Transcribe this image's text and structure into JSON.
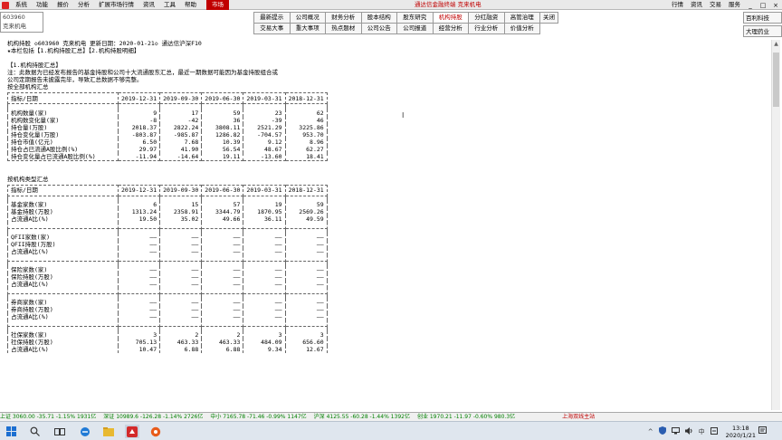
{
  "menubar": {
    "items": [
      "系统",
      "功能",
      "报价",
      "分析",
      "扩展市场行情",
      "资讯",
      "工具",
      "帮助"
    ],
    "market_label": "市场",
    "center_title": "通达信金融终端  克来机电",
    "right_items": [
      "行情",
      "资讯",
      "交易",
      "服务"
    ],
    "window_buttons": [
      "_",
      "□",
      "×"
    ]
  },
  "stock": {
    "code": "603960",
    "name": "克来机电"
  },
  "tabs": {
    "row1": [
      "最新提示",
      "公司概况",
      "财务分析",
      "股本结构",
      "股东研究",
      "机构持股",
      "分红融资",
      "高管治理",
      "关闭"
    ],
    "row2": [
      "交易大事",
      "重大事项",
      "热点题材",
      "公司公告",
      "公司报道",
      "经营分析",
      "行业分析",
      "价值分析"
    ],
    "active": "机构持股"
  },
  "side_buttons": [
    "百利科技",
    "大理药业"
  ],
  "content": {
    "header_line": "机构持股 ◇603960 克来机电 更新日期：2020-01-21◇ 通达信沪深F10",
    "index_line": "★本栏包括【1.机构持股汇总】【2.机构持股明细】",
    "section_title": "【1.机构持股汇总】",
    "note_lines": [
      "注：此数据为已经发布报告的基金持股和公司十大流通股东汇总，最近一期数据可能因为基金持股组合或",
      "公司定期报告未披露完毕，导致汇总数据不够完整。"
    ],
    "table1": {
      "caption": "按全部机构汇总",
      "header_label": "指标/日期",
      "dates": [
        "2019-12-31",
        "2019-09-30",
        "2019-06-30",
        "2019-03-31",
        "2018-12-31"
      ],
      "rows": [
        {
          "label": "机构数量(家)",
          "values": [
            "9",
            "17",
            "59",
            "23",
            "62"
          ]
        },
        {
          "label": "机构数变化量(家)",
          "values": [
            "-8",
            "-42",
            "36",
            "-39",
            "46"
          ]
        },
        {
          "label": "持仓量(万股)",
          "values": [
            "2018.37",
            "2822.24",
            "3808.11",
            "2521.29",
            "3225.86"
          ]
        },
        {
          "label": "持仓变化量(万股)",
          "values": [
            "-803.87",
            "-985.87",
            "1286.82",
            "-704.57",
            "953.70"
          ]
        },
        {
          "label": "持仓市值(亿元)",
          "values": [
            "6.50",
            "7.68",
            "10.39",
            "9.12",
            "8.96"
          ]
        },
        {
          "label": "持仓占已流通A股比例(%)",
          "values": [
            "29.97",
            "41.90",
            "56.54",
            "48.67",
            "62.27"
          ]
        },
        {
          "label": "持仓变化量占已流通A股比例(%)",
          "values": [
            "-11.94",
            "-14.64",
            "19.11",
            "-13.60",
            "18.41"
          ]
        }
      ]
    },
    "table2": {
      "caption": "按机构类型汇总",
      "header_label": "指标/日期",
      "dates": [
        "2019-12-31",
        "2019-09-30",
        "2019-06-30",
        "2019-03-31",
        "2018-12-31"
      ],
      "groups": [
        {
          "rows": [
            {
              "label": "基金家数(家)",
              "values": [
                "6",
                "15",
                "57",
                "19",
                "59"
              ]
            },
            {
              "label": "基金持股(万股)",
              "values": [
                "1313.24",
                "2358.91",
                "3344.79",
                "1870.95",
                "2569.26"
              ]
            },
            {
              "label": "占流通A比(%)",
              "values": [
                "19.50",
                "35.02",
                "49.66",
                "36.11",
                "49.59"
              ]
            }
          ]
        },
        {
          "rows": [
            {
              "label": "QFII家数(家)",
              "values": [
                "——",
                "——",
                "——",
                "——",
                "——"
              ]
            },
            {
              "label": "QFII持股(万股)",
              "values": [
                "——",
                "——",
                "——",
                "——",
                "——"
              ]
            },
            {
              "label": "占流通A比(%)",
              "values": [
                "——",
                "——",
                "——",
                "——",
                "——"
              ]
            }
          ]
        },
        {
          "rows": [
            {
              "label": "保险家数(家)",
              "values": [
                "——",
                "——",
                "——",
                "——",
                "——"
              ]
            },
            {
              "label": "保险持股(万股)",
              "values": [
                "——",
                "——",
                "——",
                "——",
                "——"
              ]
            },
            {
              "label": "占流通A比(%)",
              "values": [
                "——",
                "——",
                "——",
                "——",
                "——"
              ]
            }
          ]
        },
        {
          "rows": [
            {
              "label": "券商家数(家)",
              "values": [
                "——",
                "——",
                "——",
                "——",
                "——"
              ]
            },
            {
              "label": "券商持股(万股)",
              "values": [
                "——",
                "——",
                "——",
                "——",
                "——"
              ]
            },
            {
              "label": "占流通A比(%)",
              "values": [
                "——",
                "——",
                "——",
                "——",
                "——"
              ]
            }
          ]
        },
        {
          "rows": [
            {
              "label": "社保家数(家)",
              "values": [
                "3",
                "2",
                "2",
                "3",
                "3"
              ]
            },
            {
              "label": "社保持股(万股)",
              "values": [
                "705.13",
                "463.33",
                "463.33",
                "484.09",
                "656.60"
              ]
            },
            {
              "label": "占流通A比(%)",
              "values": [
                "10.47",
                "6.88",
                "6.88",
                "9.34",
                "12.67"
              ]
            }
          ]
        }
      ]
    }
  },
  "statusbar": {
    "items": [
      {
        "text": "上证 3060.00 -35.71 -1.15% 1931亿",
        "color": "green"
      },
      {
        "text": "深证 10989.6 -126.28 -1.14% 2726亿",
        "color": "green"
      },
      {
        "text": "中小 7165.78 -71.46 -0.99% 1147亿",
        "color": "green"
      },
      {
        "text": "沪深 4125.55 -60.28 -1.44% 1392亿",
        "color": "green"
      },
      {
        "text": "创业 1970.21 -11.97 -0.60% 980.3亿",
        "color": "green"
      },
      {
        "text": "上海双线主站",
        "color": "red"
      }
    ]
  },
  "taskbar": {
    "ime": "中",
    "time": "13:18",
    "date": "2020/1/21"
  }
}
